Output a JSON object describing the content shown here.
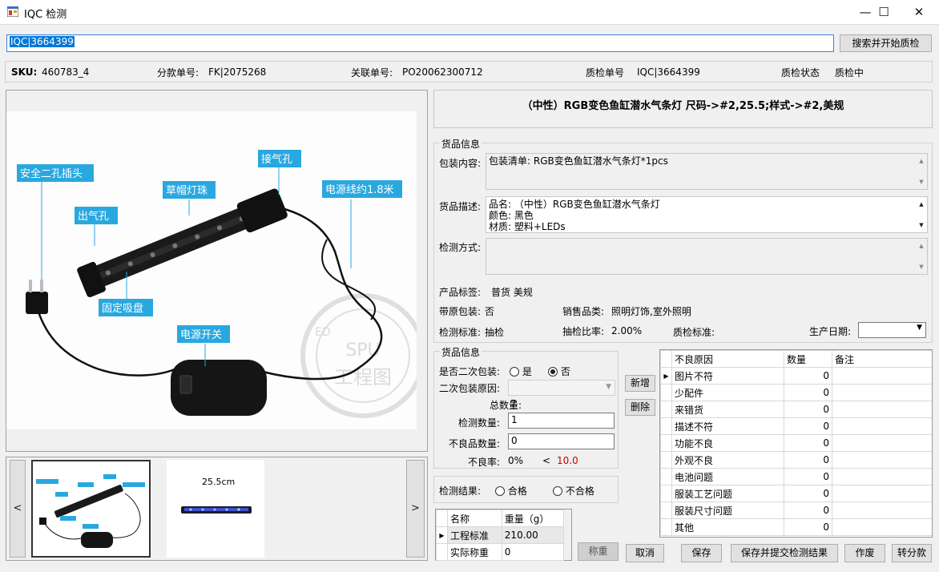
{
  "window": {
    "title": "IQC 检测",
    "minimize": "—",
    "maximize": "☐",
    "close": "✕"
  },
  "search": {
    "value": "IQC|3664399",
    "button_label": "搜索并开始质检"
  },
  "info_bar": {
    "sku_label": "SKU:",
    "sku_value": "460783_4",
    "split_label": "分款单号:",
    "split_value": "FK|2075268",
    "related_label": "关联单号:",
    "related_value": "PO20062300712",
    "qc_no_label": "质检单号",
    "qc_no_value": "IQC|3664399",
    "qc_status_label": "质检状态",
    "qc_status_value": "质检中"
  },
  "product_image": {
    "callouts": {
      "plug": "安全二孔插头",
      "air_outlet": "出气孔",
      "led_beads": "草帽灯珠",
      "air_inlet": "接气孔",
      "cable": "电源线约1.8米",
      "suction": "固定吸盘",
      "switch": "电源开关"
    },
    "watermark_top": "SPU",
    "watermark_main": "工程图",
    "watermark_side": "ED"
  },
  "thumbnails": {
    "prev": "<",
    "next": ">",
    "second_caption": "25.5cm"
  },
  "product_title": "（中性）RGB变色鱼缸潜水气条灯 尺码->#2,25.5;样式->#2,美规",
  "goods_info": {
    "group_title": "货品信息",
    "packing_label": "包装内容:",
    "packing_value": "包装清单: RGB变色鱼缸潜水气条灯*1pcs",
    "desc_label": "货品描述:",
    "desc_lines": {
      "line1": "品名: （中性）RGB变色鱼缸潜水气条灯",
      "line2": "颜色: 黑色",
      "line3": "材质: 塑料+LEDs"
    },
    "method_label": "检测方式:",
    "method_value": "",
    "tags_label": "产品标签:",
    "tags_value": "普货 美规",
    "orig_pack_label": "带原包装:",
    "orig_pack_value": "否",
    "sales_cat_label": "销售品类:",
    "sales_cat_value": "照明灯饰,室外照明",
    "std_label": "检测标准:",
    "std_value": "抽检",
    "ratio_label": "抽检比率:",
    "ratio_value": "2.00%",
    "qc_std_label": "质检标准:",
    "qc_std_value": "",
    "date_label": "生产日期:",
    "date_value": ""
  },
  "goods_info2": {
    "group_title": "货品信息",
    "secondary_label": "是否二次包装:",
    "yes": "是",
    "no": "否",
    "selected": "否",
    "reason_label": "二次包装原因:",
    "reason_value": "",
    "total_label": "总数量:",
    "total_value": "7",
    "check_qty_label": "检测数量:",
    "check_qty_value": "1",
    "defect_qty_label": "不良品数量:",
    "defect_qty_value": "0",
    "defect_rate_label": "不良率:",
    "defect_rate_value": "0%",
    "lt": "<",
    "threshold": "10.0"
  },
  "buttons": {
    "add": "新增",
    "delete": "删除",
    "weigh": "称重",
    "cancel": "取消",
    "save": "保存",
    "save_submit": "保存并提交检测结果",
    "void": "作废",
    "transfer": "转分款"
  },
  "result": {
    "label": "检测结果:",
    "pass": "合格",
    "fail": "不合格"
  },
  "weight_table": {
    "headers": {
      "name": "名称",
      "weight": "重量（g）"
    },
    "rows": [
      {
        "name": "工程标准",
        "weight": "210.00"
      },
      {
        "name": "实际称重",
        "weight": "0"
      }
    ]
  },
  "defect_table": {
    "headers": {
      "reason": "不良原因",
      "qty": "数量",
      "note": "备注"
    },
    "rows": [
      {
        "reason": "图片不符",
        "qty": "0",
        "note": ""
      },
      {
        "reason": "少配件",
        "qty": "0",
        "note": ""
      },
      {
        "reason": "来错货",
        "qty": "0",
        "note": ""
      },
      {
        "reason": "描述不符",
        "qty": "0",
        "note": ""
      },
      {
        "reason": "功能不良",
        "qty": "0",
        "note": ""
      },
      {
        "reason": "外观不良",
        "qty": "0",
        "note": ""
      },
      {
        "reason": "电池问题",
        "qty": "0",
        "note": ""
      },
      {
        "reason": "服装工艺问题",
        "qty": "0",
        "note": ""
      },
      {
        "reason": "服装尺寸问题",
        "qty": "0",
        "note": ""
      },
      {
        "reason": "其他",
        "qty": "0",
        "note": ""
      }
    ]
  },
  "colors": {
    "callout_bg": "#29a8e0",
    "selection": "#0078d7",
    "threshold_red": "#cc0000"
  }
}
